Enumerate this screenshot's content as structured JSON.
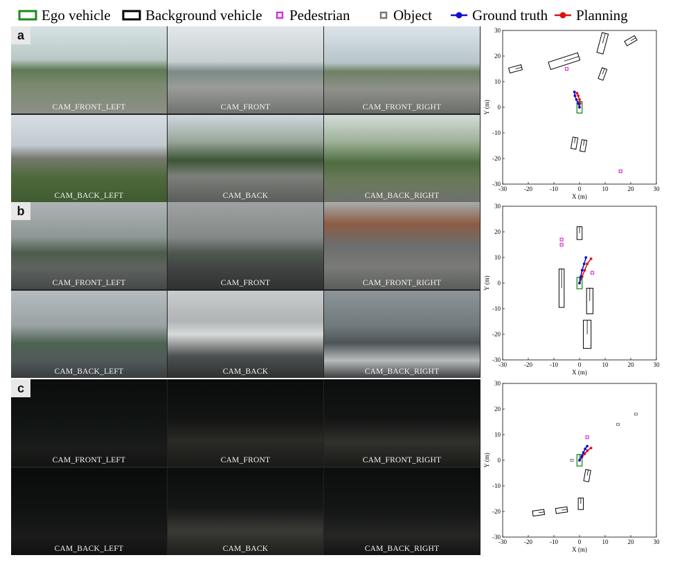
{
  "legend": [
    {
      "label": "Ego vehicle",
      "icon": "green-rectangle-icon",
      "color": "#1a8a1a"
    },
    {
      "label": "Background vehicle",
      "icon": "black-rectangle-icon",
      "color": "#000000"
    },
    {
      "label": "Pedestrian",
      "icon": "magenta-square-icon",
      "color": "#d633d6"
    },
    {
      "label": "Object",
      "icon": "gray-square-icon",
      "color": "#777777"
    },
    {
      "label": "Ground truth",
      "icon": "blue-line-dot-icon",
      "color": "#1010d0"
    },
    {
      "label": "Planning",
      "icon": "red-line-dot-icon",
      "color": "#e01010"
    }
  ],
  "panels": [
    {
      "letter": "a",
      "cameras": [
        "CAM_FRONT_LEFT",
        "CAM_FRONT",
        "CAM_FRONT_RIGHT",
        "CAM_BACK_LEFT",
        "CAM_BACK",
        "CAM_BACK_RIGHT"
      ],
      "scene": "day"
    },
    {
      "letter": "b",
      "cameras": [
        "CAM_FRONT_LEFT",
        "CAM_FRONT",
        "CAM_FRONT_RIGHT",
        "CAM_BACK_LEFT",
        "CAM_BACK",
        "CAM_BACK_RIGHT"
      ],
      "scene": "rain"
    },
    {
      "letter": "c",
      "cameras": [
        "CAM_FRONT_LEFT",
        "CAM_FRONT",
        "CAM_FRONT_RIGHT",
        "CAM_BACK_LEFT",
        "CAM_BACK",
        "CAM_BACK_RIGHT"
      ],
      "scene": "night"
    }
  ],
  "chart_data": [
    {
      "type": "scatter",
      "panel": "a",
      "xlabel": "X (m)",
      "ylabel": "Y (m)",
      "xlim": [
        -30,
        30
      ],
      "ylim": [
        -30,
        30
      ],
      "xticks": [
        -30,
        -20,
        -10,
        0,
        10,
        20,
        30
      ],
      "yticks": [
        -30,
        -20,
        -10,
        0,
        10,
        20,
        30
      ],
      "ego": {
        "x": 0,
        "y": 0,
        "w": 2,
        "h": 4.5
      },
      "vehicles": [
        {
          "x": -25,
          "y": 15,
          "w": 2,
          "h": 5,
          "angle": 75
        },
        {
          "x": -6,
          "y": 18,
          "w": 3,
          "h": 12,
          "angle": 72
        },
        {
          "x": 9,
          "y": 25,
          "w": 2.5,
          "h": 8,
          "angle": 15
        },
        {
          "x": 20,
          "y": 26,
          "w": 2,
          "h": 4.5,
          "angle": 60
        },
        {
          "x": 9,
          "y": 13,
          "w": 2,
          "h": 4.5,
          "angle": 20
        },
        {
          "x": -2,
          "y": -14,
          "w": 2,
          "h": 4.5,
          "angle": 10
        },
        {
          "x": 1.5,
          "y": -15,
          "w": 2,
          "h": 4.5,
          "angle": 10
        }
      ],
      "pedestrians": [
        {
          "x": -5,
          "y": 15
        },
        {
          "x": 16,
          "y": -25
        }
      ],
      "objects": [],
      "ground_truth": [
        {
          "x": 0,
          "y": 0
        },
        {
          "x": -0.5,
          "y": 1.5
        },
        {
          "x": -1.2,
          "y": 3
        },
        {
          "x": -1.8,
          "y": 4.5
        },
        {
          "x": -2,
          "y": 6
        }
      ],
      "planning": [
        {
          "x": 0,
          "y": 0
        },
        {
          "x": 0.2,
          "y": 1.5
        },
        {
          "x": 0,
          "y": 3
        },
        {
          "x": -0.5,
          "y": 4.5
        },
        {
          "x": -1,
          "y": 5.5
        }
      ]
    },
    {
      "type": "scatter",
      "panel": "b",
      "xlabel": "X (m)",
      "ylabel": "Y (m)",
      "xlim": [
        -30,
        30
      ],
      "ylim": [
        -30,
        30
      ],
      "xticks": [
        -30,
        -20,
        -10,
        0,
        10,
        20,
        30
      ],
      "yticks": [
        -30,
        -20,
        -10,
        0,
        10,
        20,
        30
      ],
      "ego": {
        "x": 0,
        "y": 0,
        "w": 2,
        "h": 4.5
      },
      "vehicles": [
        {
          "x": 0,
          "y": 19.5,
          "w": 2,
          "h": 5,
          "angle": 0
        },
        {
          "x": -7,
          "y": -2,
          "w": 2,
          "h": 15,
          "angle": 0
        },
        {
          "x": 4,
          "y": -7,
          "w": 2.5,
          "h": 10,
          "angle": 0
        },
        {
          "x": 3,
          "y": -20,
          "w": 3,
          "h": 11,
          "angle": 0
        }
      ],
      "pedestrians": [
        {
          "x": -7,
          "y": 17
        },
        {
          "x": -7,
          "y": 15
        },
        {
          "x": 5,
          "y": 4
        }
      ],
      "objects": [],
      "ground_truth": [
        {
          "x": 0,
          "y": 0
        },
        {
          "x": 0.5,
          "y": 2.5
        },
        {
          "x": 1,
          "y": 5
        },
        {
          "x": 1.8,
          "y": 7.5
        },
        {
          "x": 2.5,
          "y": 10
        }
      ],
      "planning": [
        {
          "x": 0,
          "y": 0
        },
        {
          "x": 1,
          "y": 2.5
        },
        {
          "x": 2,
          "y": 5
        },
        {
          "x": 3,
          "y": 7.5
        },
        {
          "x": 4.5,
          "y": 9.5
        }
      ]
    },
    {
      "type": "scatter",
      "panel": "c",
      "xlabel": "X (m)",
      "ylabel": "Y (m)",
      "xlim": [
        -30,
        30
      ],
      "ylim": [
        -30,
        30
      ],
      "xticks": [
        -30,
        -20,
        -10,
        0,
        10,
        20,
        30
      ],
      "yticks": [
        -30,
        -20,
        -10,
        0,
        10,
        20,
        30
      ],
      "ego": {
        "x": 0,
        "y": 0,
        "w": 2,
        "h": 4.5
      },
      "vehicles": [
        {
          "x": 3,
          "y": -6,
          "w": 2,
          "h": 4.5,
          "angle": 10
        },
        {
          "x": 0.5,
          "y": -17,
          "w": 2,
          "h": 4.5,
          "angle": 0
        },
        {
          "x": -7,
          "y": -19.5,
          "w": 2,
          "h": 4.5,
          "angle": 82
        },
        {
          "x": -16,
          "y": -20.5,
          "w": 2,
          "h": 4.5,
          "angle": 82
        }
      ],
      "pedestrians": [
        {
          "x": 3,
          "y": 9
        }
      ],
      "objects": [
        {
          "x": -3,
          "y": 0
        },
        {
          "x": 15,
          "y": 14
        },
        {
          "x": 22,
          "y": 18
        }
      ],
      "ground_truth": [
        {
          "x": 0,
          "y": 0
        },
        {
          "x": 0.8,
          "y": 1.5
        },
        {
          "x": 1.5,
          "y": 3
        },
        {
          "x": 2.2,
          "y": 4.5
        },
        {
          "x": 3,
          "y": 5.5
        }
      ],
      "planning": [
        {
          "x": 0,
          "y": 0
        },
        {
          "x": 1,
          "y": 1.3
        },
        {
          "x": 2,
          "y": 2.5
        },
        {
          "x": 3,
          "y": 3.7
        },
        {
          "x": 4.5,
          "y": 4.8
        }
      ]
    }
  ]
}
